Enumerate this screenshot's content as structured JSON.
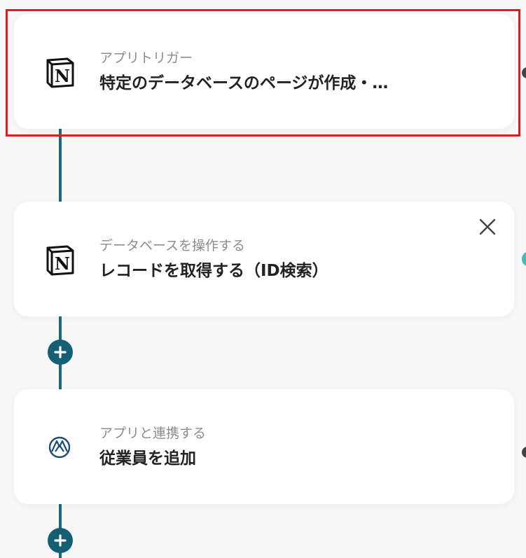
{
  "steps": [
    {
      "subtitle": "アプリトリガー",
      "title": "特定のデータベースのページが作成・…",
      "app_icon": "notion-icon",
      "selected": true
    },
    {
      "subtitle": "データベースを操作する",
      "title": "レコードを取得する（ID検索）",
      "app_icon": "notion-icon",
      "has_close": true
    },
    {
      "subtitle": "アプリと連携する",
      "title": "従業員を追加",
      "app_icon": "smarthr-icon"
    }
  ],
  "colors": {
    "connector": "#1a6a7e",
    "add_button": "#155f75",
    "selected_border": "#d91f1f",
    "card_background": "#ffffff",
    "page_background": "#f7f7f7"
  },
  "icons": {
    "close": "close-icon",
    "add": "plus-icon"
  }
}
